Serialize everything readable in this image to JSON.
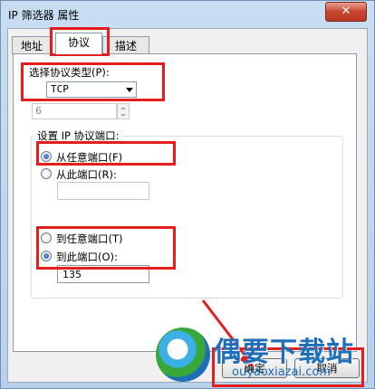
{
  "window": {
    "title": "IP 筛选器 属性",
    "close_glyph": "✕"
  },
  "tabs": [
    {
      "label": "地址",
      "active": false
    },
    {
      "label": "协议",
      "active": true
    },
    {
      "label": "描述",
      "active": false
    }
  ],
  "protocol": {
    "type_label": "选择协议类型(P):",
    "type_value": "TCP",
    "number_value": "6"
  },
  "ports": {
    "group_label": "设置 IP 协议端口:",
    "from_any_label": "从任意端口(F)",
    "from_this_label": "从此端口(R):",
    "from_this_value": "",
    "to_any_label": "到任意端口(T)",
    "to_this_label": "到此端口(O):",
    "to_this_value": "135",
    "selected_from": "from_any",
    "selected_to": "to_this"
  },
  "buttons": {
    "ok_label": "确定",
    "cancel_label": "取消"
  },
  "watermark": {
    "text": "偶要下载站",
    "url": "ouyaoxiazai.com"
  },
  "colors": {
    "annotation": "#e41d1d",
    "watermark": "#1f6fb8"
  }
}
